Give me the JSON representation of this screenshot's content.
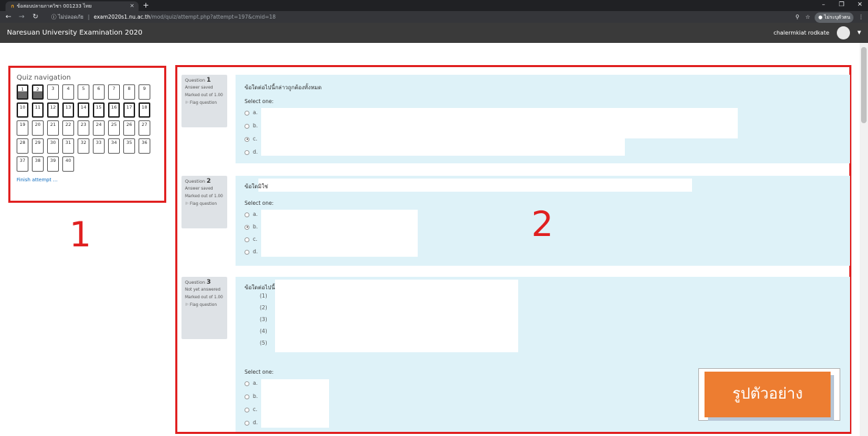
{
  "browser": {
    "tab_title": "ข้อสอบปลายภาควิชา 001233 ไทย",
    "tab_favicon": "ก",
    "security_label": "ไม่ปลอดภัย",
    "url_host": "exam2020s1.nu.ac.th",
    "url_path": "/mod/quiz/attempt.php?attempt=197&cmid=18",
    "profile_label": "ไม่ระบุตัวตน"
  },
  "navbar": {
    "site_title": "Naresuan University Examination 2020",
    "username": "chalermkiat rodkate"
  },
  "quiz_nav": {
    "title": "Quiz navigation",
    "buttons": [
      "1",
      "2",
      "3",
      "4",
      "5",
      "6",
      "7",
      "8",
      "9",
      "10",
      "11",
      "12",
      "13",
      "14",
      "15",
      "16",
      "17",
      "18",
      "19",
      "20",
      "21",
      "22",
      "23",
      "24",
      "25",
      "26",
      "27",
      "28",
      "29",
      "30",
      "31",
      "32",
      "33",
      "34",
      "35",
      "36",
      "37",
      "38",
      "39",
      "40"
    ],
    "answered_count": 2,
    "finish_label": "Finish attempt ..."
  },
  "markers": {
    "m1": "1",
    "m2": "2"
  },
  "questions": [
    {
      "label": "Question",
      "number": "1",
      "state": "Answer saved",
      "marked": "Marked out of 1.00",
      "flag": "Flag question",
      "text": "ข้อใดต่อไปนี้กล่าวถูกต้องทั้งหมด",
      "select_label": "Select one:",
      "options": [
        "a.",
        "b.",
        "c.",
        "d."
      ],
      "checked_index": 2
    },
    {
      "label": "Question",
      "number": "2",
      "state": "Answer saved",
      "marked": "Marked out of 1.00",
      "flag": "Flag question",
      "text": "ข้อใดมิใช่",
      "select_label": "Select one:",
      "options": [
        "a.",
        "b.",
        "c.",
        "d."
      ],
      "checked_index": 1
    },
    {
      "label": "Question",
      "number": "3",
      "state": "Not yet answered",
      "marked": "Marked out of 1.00",
      "flag": "Flag question",
      "text": "ข้อใดต่อไปนี้",
      "items": [
        "(1)",
        "(2)",
        "(3)",
        "(4)",
        "(5)"
      ],
      "select_label": "Select one:",
      "options": [
        "a.",
        "b.",
        "c.",
        "d."
      ],
      "checked_index": -1
    }
  ],
  "stamp": {
    "label": "รูปตัวอย่าง"
  }
}
